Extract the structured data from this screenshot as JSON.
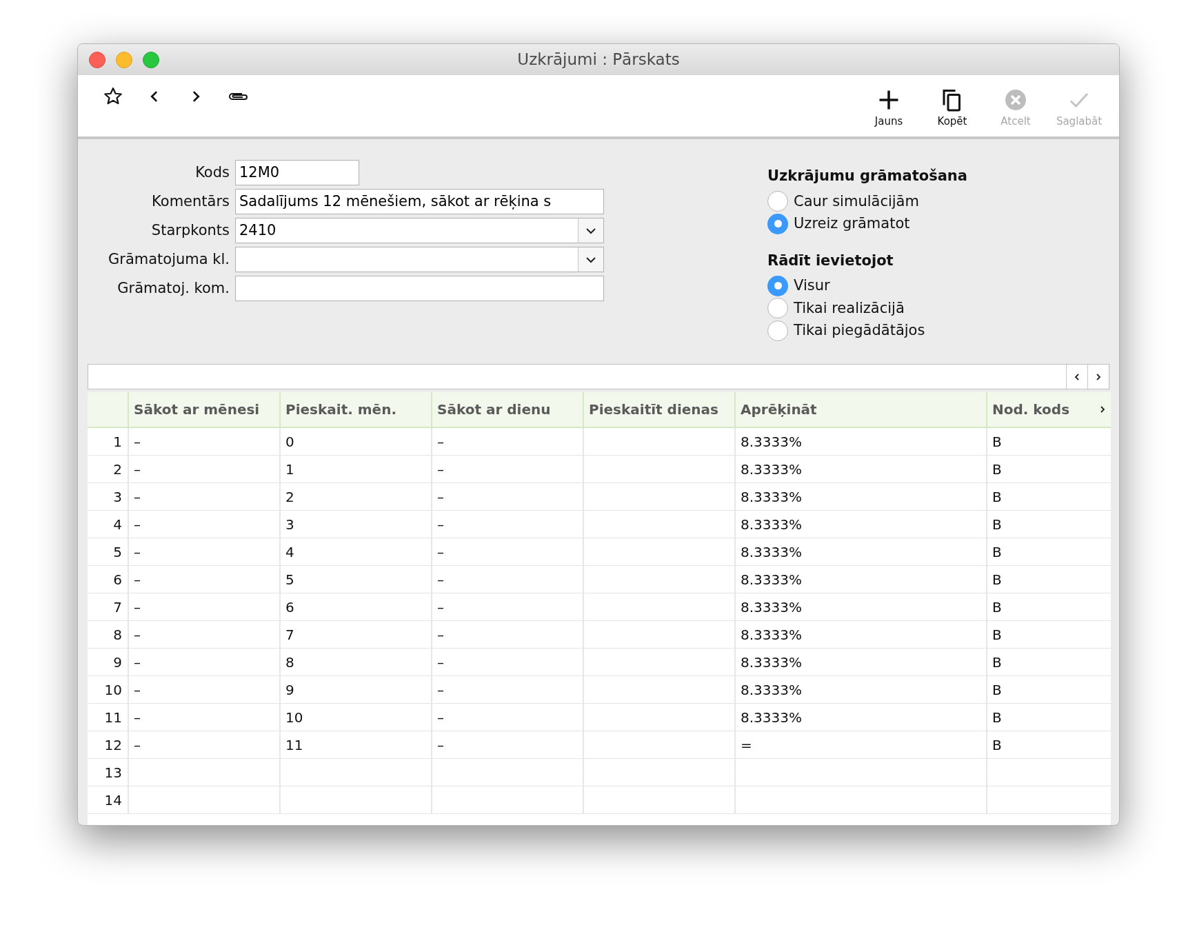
{
  "window": {
    "title": "Uzkrājumi : Pārskats"
  },
  "toolbar": {
    "buttons": [
      {
        "label": "Jauns",
        "kind": "plus",
        "disabled": false
      },
      {
        "label": "Kopēt",
        "kind": "copy",
        "disabled": false
      },
      {
        "label": "Atcelt",
        "kind": "cancel",
        "disabled": true
      },
      {
        "label": "Saglabāt",
        "kind": "check",
        "disabled": true
      }
    ]
  },
  "form": {
    "fields": [
      {
        "label": "Kods",
        "value": "12M0",
        "kind": "short"
      },
      {
        "label": "Komentārs",
        "value": "Sadalījums 12 mēnešiem, sākot ar rēķina s",
        "kind": "text"
      },
      {
        "label": "Starpkonts",
        "value": "2410",
        "kind": "dropdown"
      },
      {
        "label": "Grāmatojuma kl.",
        "kind": "dropdown"
      },
      {
        "label": "Grāmatoj. kom.",
        "kind": "text"
      }
    ]
  },
  "options": [
    {
      "title": "Uzkrājumu grāmatošana",
      "choices": [
        {
          "label": "Caur simulācijām",
          "selected": false
        },
        {
          "label": "Uzreiz grāmatot",
          "selected": true
        }
      ]
    },
    {
      "title": "Rādīt ievietojot",
      "choices": [
        {
          "label": "Visur",
          "selected": true
        },
        {
          "label": "Tikai realizācijā",
          "selected": false
        },
        {
          "label": "Tikai piegādātājos",
          "selected": false
        }
      ]
    }
  ],
  "table": {
    "columns": [
      "Sākot ar mēnesi",
      "Pieskait. mēn.",
      "Sākot ar dienu",
      "Pieskaitīt dienas",
      "Aprēķināt",
      "Nod. kods"
    ],
    "rows": [
      {
        "number": "1",
        "cells": {
          "0": "–",
          "1": "0",
          "2": "–",
          "4": "8.3333%",
          "5": "B"
        }
      },
      {
        "number": "2",
        "cells": {
          "0": "–",
          "1": "1",
          "2": "–",
          "4": "8.3333%",
          "5": "B"
        }
      },
      {
        "number": "3",
        "cells": {
          "0": "–",
          "1": "2",
          "2": "–",
          "4": "8.3333%",
          "5": "B"
        }
      },
      {
        "number": "4",
        "cells": {
          "0": "–",
          "1": "3",
          "2": "–",
          "4": "8.3333%",
          "5": "B"
        }
      },
      {
        "number": "5",
        "cells": {
          "0": "–",
          "1": "4",
          "2": "–",
          "4": "8.3333%",
          "5": "B"
        }
      },
      {
        "number": "6",
        "cells": {
          "0": "–",
          "1": "5",
          "2": "–",
          "4": "8.3333%",
          "5": "B"
        }
      },
      {
        "number": "7",
        "cells": {
          "0": "–",
          "1": "6",
          "2": "–",
          "4": "8.3333%",
          "5": "B"
        }
      },
      {
        "number": "8",
        "cells": {
          "0": "–",
          "1": "7",
          "2": "–",
          "4": "8.3333%",
          "5": "B"
        }
      },
      {
        "number": "9",
        "cells": {
          "0": "–",
          "1": "8",
          "2": "–",
          "4": "8.3333%",
          "5": "B"
        }
      },
      {
        "number": "10",
        "cells": {
          "0": "–",
          "1": "9",
          "2": "–",
          "4": "8.3333%",
          "5": "B"
        }
      },
      {
        "number": "11",
        "cells": {
          "0": "–",
          "1": "10",
          "2": "–",
          "4": "8.3333%",
          "5": "B"
        }
      },
      {
        "number": "12",
        "cells": {
          "0": "–",
          "1": "11",
          "2": "–",
          "4": "=",
          "5": "B"
        }
      },
      {
        "number": "13"
      },
      {
        "number": "14"
      }
    ]
  }
}
